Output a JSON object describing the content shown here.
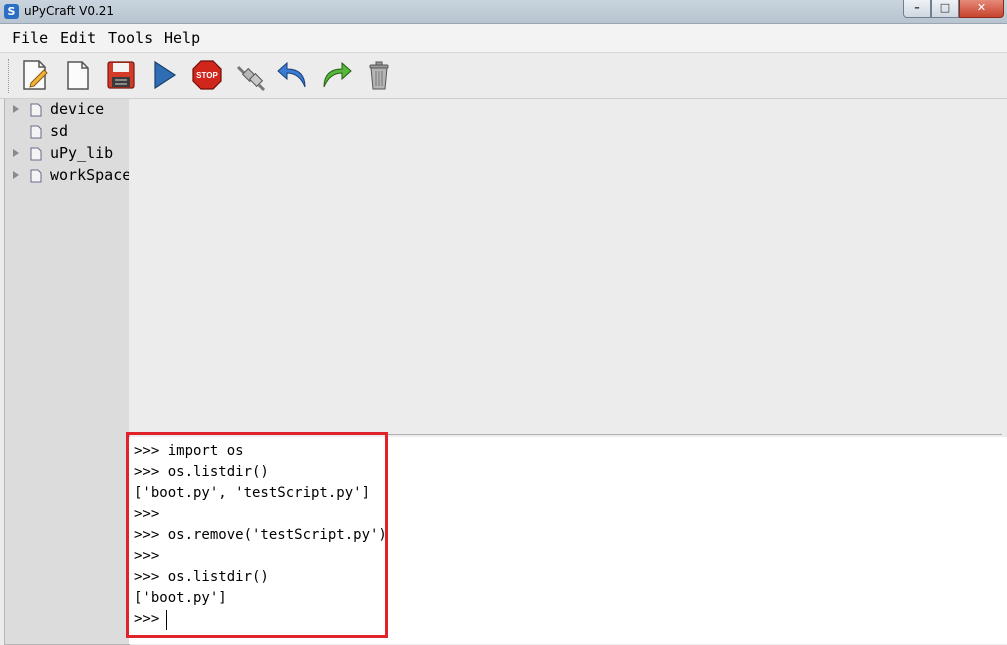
{
  "window": {
    "title": "uPyCraft V0.21",
    "app_icon_glyph": "S",
    "controls": {
      "minimize": "–",
      "maximize": "□",
      "close": "✕"
    }
  },
  "menu": [
    "File",
    "Edit",
    "Tools",
    "Help"
  ],
  "toolbar": {
    "buttons": [
      {
        "name": "new-file-icon"
      },
      {
        "name": "open-file-icon"
      },
      {
        "name": "save-icon"
      },
      {
        "name": "run-icon"
      },
      {
        "name": "stop-icon",
        "text": "STOP"
      },
      {
        "name": "connect-icon"
      },
      {
        "name": "undo-icon"
      },
      {
        "name": "redo-icon"
      },
      {
        "name": "trash-icon"
      }
    ]
  },
  "tree": [
    {
      "label": "device",
      "expandable": true
    },
    {
      "label": "sd",
      "expandable": false
    },
    {
      "label": "uPy_lib",
      "expandable": true
    },
    {
      "label": "workSpace",
      "expandable": true
    }
  ],
  "terminal": {
    "lines": [
      ">>> import os",
      ">>> os.listdir()",
      "['boot.py', 'testScript.py']",
      ">>>",
      ">>> os.remove('testScript.py')",
      ">>>",
      ">>> os.listdir()",
      "['boot.py']",
      ">>> "
    ]
  },
  "colors": {
    "highlight": "#e0222b",
    "accent": "#2a6fc3"
  }
}
